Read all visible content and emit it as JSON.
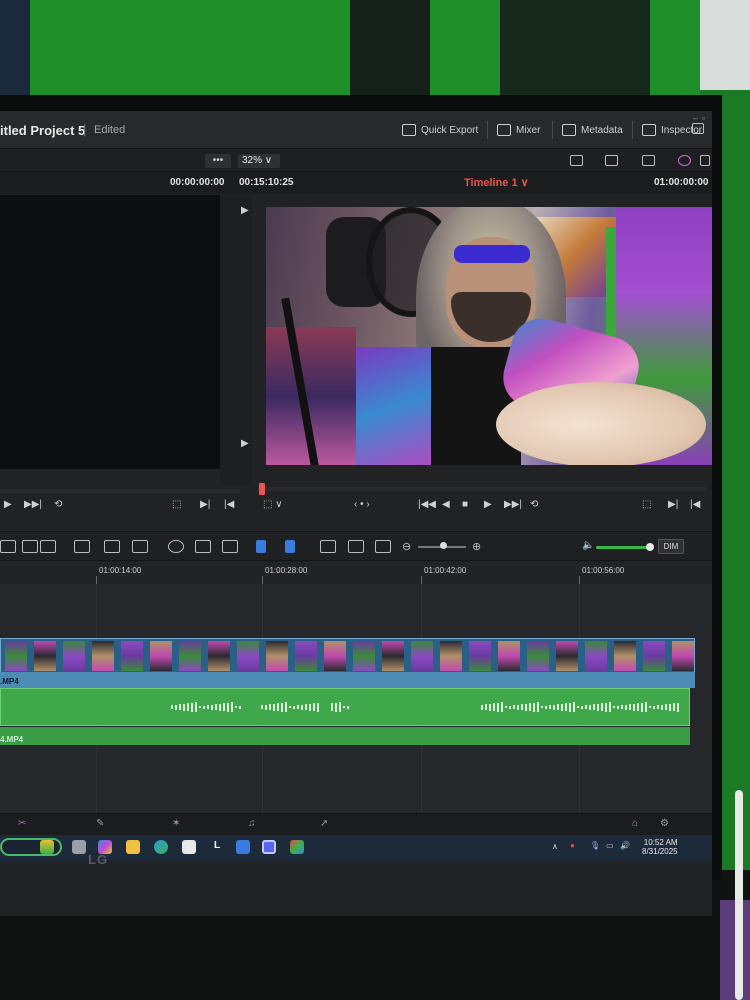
{
  "titlebar": {
    "project_title": "itled Project 5",
    "separator": "|",
    "status": "Edited",
    "quick_export": "Quick Export",
    "mixer": "Mixer",
    "metadata": "Metadata",
    "inspector": "Inspector"
  },
  "viewer_toolbar": {
    "dots": "•••",
    "zoom": "32% ∨"
  },
  "timecodes": {
    "source_tc": "00:00:00:00",
    "program_duration": "00:15:10:25",
    "timeline_name": "Timeline 1 ∨",
    "program_tc": "01:00:00:00"
  },
  "ruler": {
    "labels": [
      "01:00:14:00",
      "01:00:28:00",
      "01:00:42:00",
      "01:00:56:00"
    ]
  },
  "tracks": {
    "video_clip_name": ".MP4",
    "audio_clip_name": "4.MP4"
  },
  "timeline_toolbar": {
    "dim": "DIM"
  },
  "transport": {
    "nav_dots": "‹ • ›"
  },
  "taskbar": {
    "time": "10:52 AM",
    "date": "8/31/2025",
    "letter_app": "L"
  },
  "monitor": {
    "brand": "LG"
  },
  "colors": {
    "timeline_name": "#e8564f",
    "video_clip": "#2a5f86",
    "audio_clip": "#3ea84a"
  }
}
